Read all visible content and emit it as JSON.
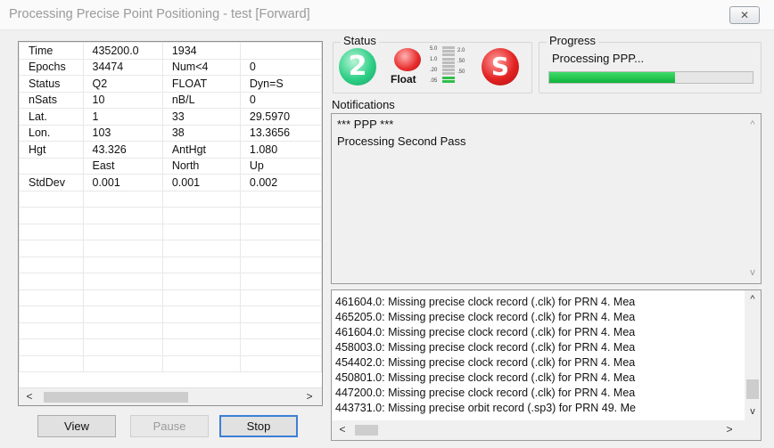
{
  "window": {
    "title": "Processing Precise Point Positioning - test [Forward]",
    "close_icon": "close-icon"
  },
  "grid": {
    "rows": [
      [
        "Time",
        "435200.0",
        "1934",
        ""
      ],
      [
        "Epochs",
        "34474",
        "Num<4",
        "0"
      ],
      [
        "Status",
        "Q2",
        "FLOAT",
        "Dyn=S"
      ],
      [
        "nSats",
        "10",
        "nB/L",
        "0"
      ],
      [
        "Lat.",
        "1",
        "33",
        "29.5970"
      ],
      [
        "Lon.",
        "103",
        "38",
        "13.3656"
      ],
      [
        "Hgt",
        "43.326",
        "AntHgt",
        "1.080"
      ],
      [
        "",
        "East",
        "North",
        "Up"
      ],
      [
        "StdDev",
        "0.001",
        "0.001",
        "0.002"
      ],
      [
        "",
        "",
        "",
        ""
      ],
      [
        "",
        "",
        "",
        ""
      ],
      [
        "",
        "",
        "",
        ""
      ],
      [
        "",
        "",
        "",
        ""
      ],
      [
        "",
        "",
        "",
        ""
      ],
      [
        "",
        "",
        "",
        ""
      ],
      [
        "",
        "",
        "",
        ""
      ],
      [
        "",
        "",
        "",
        ""
      ],
      [
        "",
        "",
        "",
        ""
      ],
      [
        "",
        "",
        "",
        ""
      ],
      [
        "",
        "",
        "",
        ""
      ]
    ],
    "scroll_left": "<",
    "scroll_right": ">"
  },
  "buttons": {
    "view": "View",
    "pause": "Pause",
    "stop": "Stop"
  },
  "status": {
    "label": "Status",
    "indicator_2": "2",
    "float_label": "Float",
    "bar_ticks": [
      "5.0",
      "2.0",
      "1.0",
      ".50",
      ".20",
      ".50",
      ".05"
    ],
    "signal_level": 0.2,
    "indicator_s": "S"
  },
  "progress": {
    "label": "Progress",
    "text": "Processing PPP...",
    "fraction": 0.62
  },
  "notifications": {
    "label": "Notifications",
    "lines": [
      "*** PPP ***",
      "Processing Second Pass"
    ],
    "up": "^",
    "down": "v"
  },
  "log": {
    "lines": [
      "461604.0: Missing precise clock record (.clk) for PRN 4.  Mea",
      "465205.0: Missing precise clock record (.clk) for PRN 4.  Mea",
      "461604.0: Missing precise clock record (.clk) for PRN 4.  Mea",
      "458003.0: Missing precise clock record (.clk) for PRN 4.  Mea",
      "454402.0: Missing precise clock record (.clk) for PRN 4.  Mea",
      "450801.0: Missing precise clock record (.clk) for PRN 4.  Mea",
      "447200.0: Missing precise clock record (.clk) for PRN 4.  Mea",
      "443731.0: Missing precise orbit record (.sp3) for PRN 49.  Me"
    ],
    "up": "^",
    "down": "v",
    "left": "<",
    "right": ">"
  },
  "colors": {
    "progress": "#1db94a",
    "status_green": "#2fcf86",
    "status_red": "#e32222",
    "default_button_border": "#3c7fd6"
  }
}
